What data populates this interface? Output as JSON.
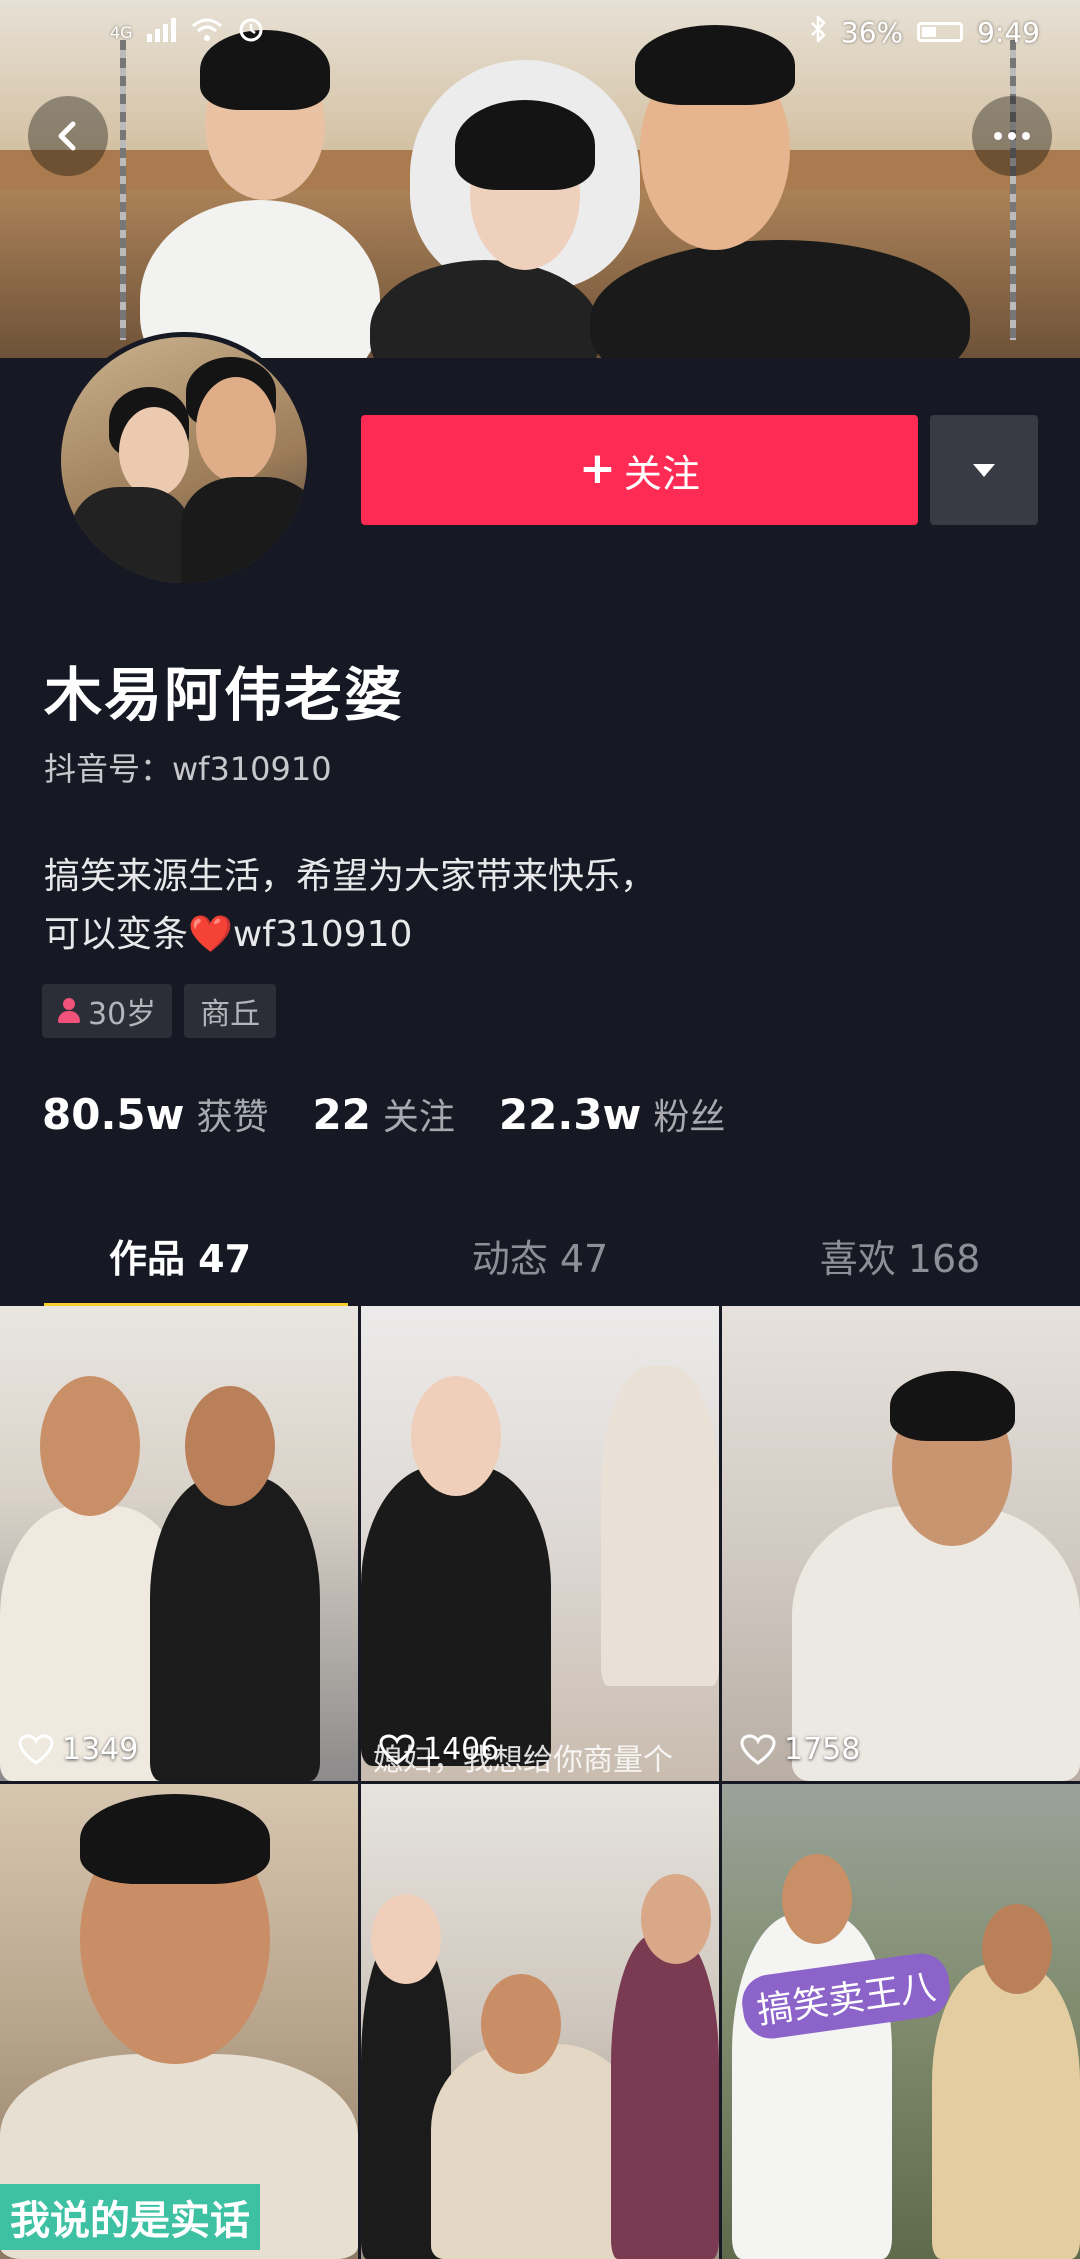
{
  "status_bar": {
    "network": "4G",
    "battery": "36%",
    "time": "9:49"
  },
  "profile": {
    "nickname": "木易阿伟老婆",
    "douyin_id": "抖音号：wf310910",
    "bio_line1": "搞笑来源生活，希望为大家带来快乐，",
    "bio_line2_prefix": "可以变条",
    "bio_line2_suffix": "wf310910",
    "follow_label": "关注",
    "tags": {
      "age": "30岁",
      "location": "商丘"
    },
    "stats": {
      "likes_num": "80.5w",
      "likes_label": "获赞",
      "following_num": "22",
      "following_label": "关注",
      "followers_num": "22.3w",
      "followers_label": "粉丝"
    }
  },
  "tabs": {
    "works": "作品 47",
    "dynamic": "动态 47",
    "likes": "喜欢 168"
  },
  "videos": [
    {
      "likes": "1349",
      "caption": ""
    },
    {
      "likes": "1406",
      "caption": "媳妇，我想给你商量个"
    },
    {
      "likes": "1758",
      "caption": ""
    },
    {
      "likes": "",
      "caption": "我说的是实话"
    },
    {
      "likes": "",
      "caption": ""
    },
    {
      "likes": "",
      "caption": "搞笑卖王八"
    }
  ],
  "colors": {
    "background": "#161823",
    "follow_button": "#fe2c55",
    "tab_indicator": "#facd2f"
  },
  "icons": [
    "back-icon",
    "more-icon",
    "caret-down-icon",
    "gender-icon",
    "heart-icon",
    "wifi-icon",
    "signal-icon",
    "bluetooth-icon",
    "alarm-icon",
    "battery-icon"
  ]
}
